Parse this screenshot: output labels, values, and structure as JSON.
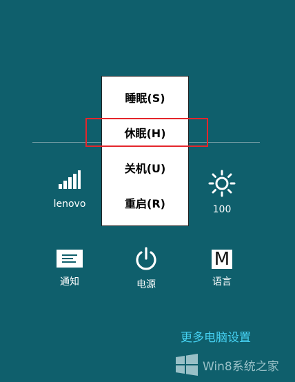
{
  "power_menu": {
    "items": [
      {
        "label": "睡眠(S)"
      },
      {
        "label": "休眠(H)"
      },
      {
        "label": "关机(U)"
      },
      {
        "label": "重启(R)"
      }
    ],
    "highlighted_item": "休眠(H)",
    "highlight_color": "#e4262b"
  },
  "settings": {
    "network": {
      "label": "lenovo",
      "icon": "signal-icon"
    },
    "brightness": {
      "label": "100",
      "icon": "brightness-icon"
    },
    "notifications": {
      "label": "通知",
      "icon": "notifications-icon"
    },
    "power": {
      "label": "电源",
      "icon": "power-icon"
    },
    "language": {
      "label": "语言",
      "icon": "language-icon",
      "glyph": "M"
    }
  },
  "more_settings_link": "更多电脑设置",
  "watermark": {
    "text": "Win8系统之家"
  },
  "colors": {
    "background": "#0f5f6c",
    "link": "#46d2f3",
    "menu_bg": "#ffffff"
  }
}
